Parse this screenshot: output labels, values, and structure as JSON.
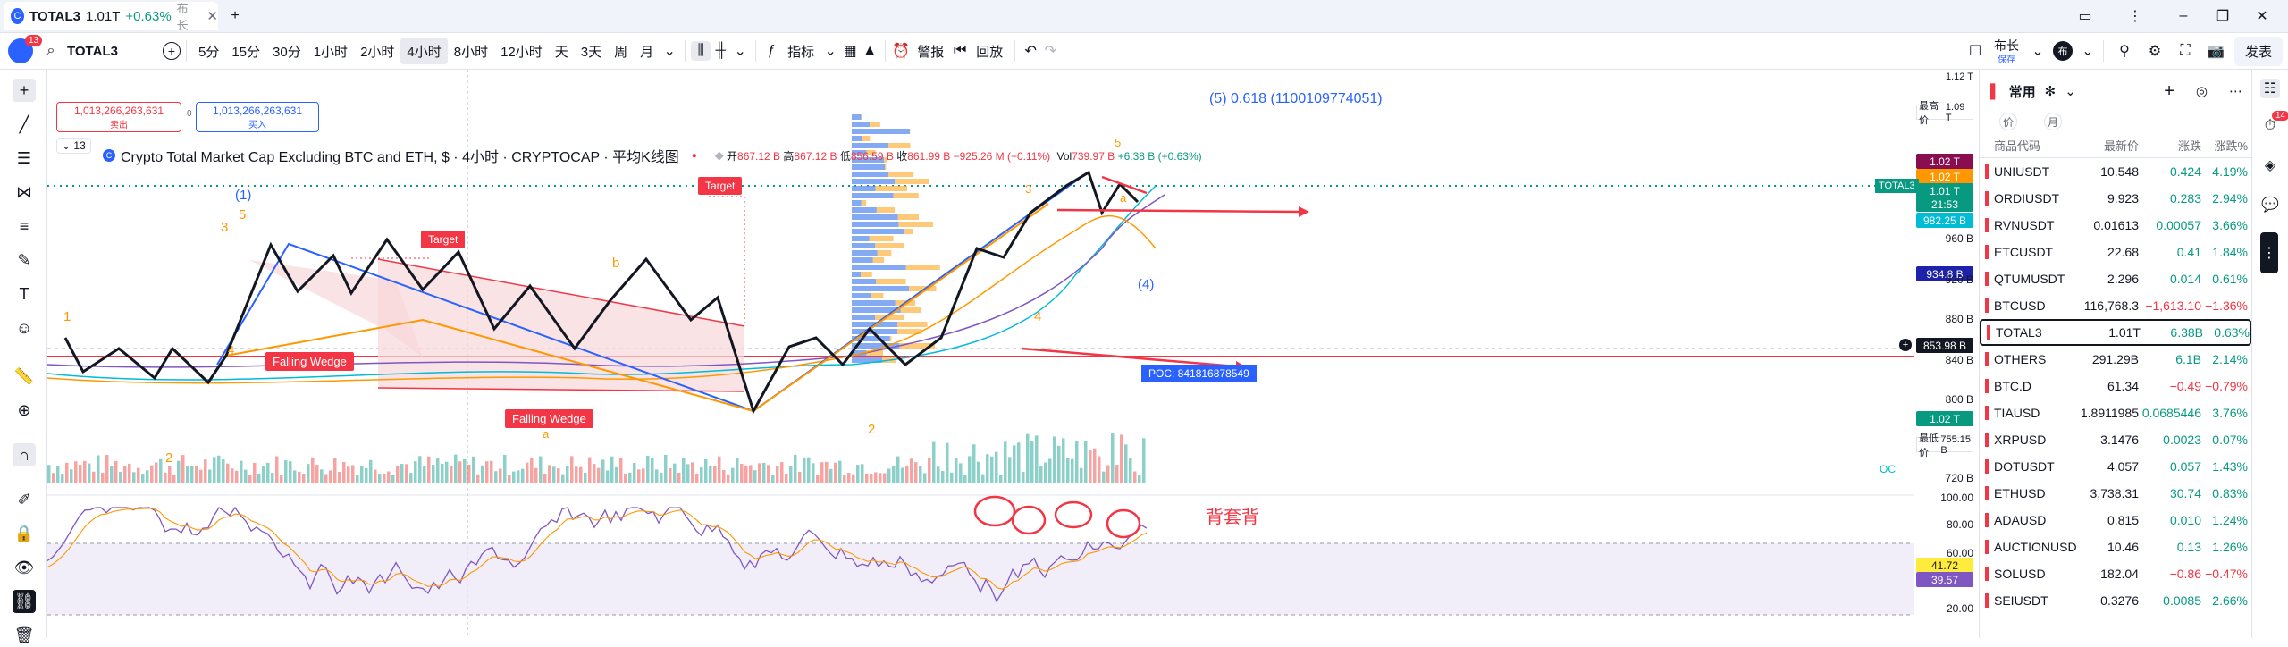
{
  "tabbar": {
    "tab_symbol": "TOTAL3",
    "tab_price": "1.01T",
    "tab_change": "+0.63%",
    "tab_layout": "布长",
    "logo_text": "13"
  },
  "toolbar": {
    "symbol": "TOTAL3",
    "intervals": [
      "5分",
      "15分",
      "30分",
      "1小时",
      "2小时",
      "4小时",
      "8小时",
      "12小时",
      "天",
      "3天",
      "周",
      "月"
    ],
    "active_interval": "4小时",
    "indicators_label": "指标",
    "alert_label": "警报",
    "replay_label": "回放",
    "layout_label": "布长",
    "layout_sub": "保存",
    "publish_label": "发表",
    "avatar_badge": "13",
    "user_badge": "布"
  },
  "legend": {
    "title": "Crypto Total Market Cap Excluding BTC and ETH, $ · 4小时 · CRYPTOCAP · 平均K线图",
    "open_label": "开",
    "open": "867.12 B",
    "high_label": "高",
    "high": "867.12 B",
    "low_label": "低",
    "low": "856.59 B",
    "close_label": "收",
    "close": "861.99 B",
    "change": "−925.26 M (−0.11%)",
    "vol_label": "Vol",
    "vol": "739.97 B",
    "vol_change": "+6.38 B (+0.63%)",
    "sell_price": "1,013,266,263,631",
    "sell_label": "卖出",
    "buy_price": "1,013,266,263,631",
    "buy_label": "买入",
    "collapse_count": "13"
  },
  "annotations": {
    "fib_label": "(5) 0.618 (1100109774051)",
    "target1": "Target",
    "target2": "Target",
    "wedge1": "Falling Wedge",
    "wedge2": "Falling Wedge",
    "poc": "POC: 841816878549",
    "divergence": "背套背",
    "wave_1_paren": "(1)",
    "wave_4_paren": "(4)",
    "w3": "3",
    "w5": "5",
    "w1": "1",
    "w4": "4",
    "w2": "2",
    "wb": "b",
    "wa": "a",
    "w2b": "2",
    "w4b": "4",
    "w3b": "3",
    "w5b": "5",
    "wa2": "a",
    "oc": "OC"
  },
  "price_axis": {
    "labels": [
      "1.12 T",
      "960 B",
      "920 B",
      "880 B",
      "840 B",
      "800 B",
      "720 B",
      "100.00",
      "80.00",
      "60.00",
      "20.00"
    ],
    "high_label": "最高价",
    "high_value": "1.09 T",
    "low_label": "最低价",
    "low_value": "755.15 B",
    "tags": [
      {
        "text": "1.02 T",
        "color": "#880e4f"
      },
      {
        "text": "1.02 T",
        "color": "#ff9800"
      },
      {
        "text": "1.01 T",
        "color": "#089981"
      },
      {
        "text": "21:53",
        "color": "#089981"
      },
      {
        "text": "982.25 B",
        "color": "#00bcd4"
      },
      {
        "text": "934.8 B",
        "color": "#1e22aa"
      },
      {
        "text": "853.98 B",
        "color": "#131722"
      },
      {
        "text": "1.02 T",
        "color": "#089981"
      },
      {
        "text": "41.72",
        "color": "#ffeb3b"
      },
      {
        "text": "39.57",
        "color": "#7e57c2"
      }
    ],
    "symbol_tag": "TOTAL3"
  },
  "watchlist": {
    "title": "常用",
    "tab1": "价",
    "tab2": "月",
    "columns": [
      "商品代码",
      "最新价",
      "涨跌",
      "涨跌%"
    ],
    "badge": "14",
    "rows": [
      {
        "sym": "UNIUSDT",
        "last": "10.548",
        "chg": "0.424",
        "pct": "4.19%",
        "dir": "up"
      },
      {
        "sym": "ORDIUSDT",
        "last": "9.923",
        "chg": "0.283",
        "pct": "2.94%",
        "dir": "up"
      },
      {
        "sym": "RVNUSDT",
        "last": "0.01613",
        "chg": "0.00057",
        "pct": "3.66%",
        "dir": "up"
      },
      {
        "sym": "ETCUSDT",
        "last": "22.68",
        "chg": "0.41",
        "pct": "1.84%",
        "dir": "up"
      },
      {
        "sym": "QTUMUSDT",
        "last": "2.296",
        "chg": "0.014",
        "pct": "0.61%",
        "dir": "up"
      },
      {
        "sym": "BTCUSD",
        "last": "116,768.3",
        "chg": "−1,613.10",
        "pct": "−1.36%",
        "dir": "down"
      },
      {
        "sym": "TOTAL3",
        "last": "1.01T",
        "chg": "6.38B",
        "pct": "0.63%",
        "dir": "up"
      },
      {
        "sym": "OTHERS",
        "last": "291.29B",
        "chg": "6.1B",
        "pct": "2.14%",
        "dir": "up"
      },
      {
        "sym": "BTC.D",
        "last": "61.34",
        "chg": "−0.49",
        "pct": "−0.79%",
        "dir": "down"
      },
      {
        "sym": "TIAUSD",
        "last": "1.8911985",
        "chg": "0.0685446",
        "pct": "3.76%",
        "dir": "up"
      },
      {
        "sym": "XRPUSD",
        "last": "3.1476",
        "chg": "0.0023",
        "pct": "0.07%",
        "dir": "up"
      },
      {
        "sym": "DOTUSDT",
        "last": "4.057",
        "chg": "0.057",
        "pct": "1.43%",
        "dir": "up"
      },
      {
        "sym": "ETHUSD",
        "last": "3,738.31",
        "chg": "30.74",
        "pct": "0.83%",
        "dir": "up"
      },
      {
        "sym": "ADAUSD",
        "last": "0.815",
        "chg": "0.010",
        "pct": "1.24%",
        "dir": "up"
      },
      {
        "sym": "AUCTIONUSD",
        "last": "10.46",
        "chg": "0.13",
        "pct": "1.26%",
        "dir": "up"
      },
      {
        "sym": "SOLUSD",
        "last": "182.04",
        "chg": "−0.86",
        "pct": "−0.47%",
        "dir": "down"
      },
      {
        "sym": "SEIUSDT",
        "last": "0.3276",
        "chg": "0.0085",
        "pct": "2.66%",
        "dir": "up"
      }
    ]
  },
  "colors": {
    "up": "#089981",
    "down": "#f23645",
    "accent": "#2962ff",
    "wedge_fill": "#f8d7da"
  }
}
